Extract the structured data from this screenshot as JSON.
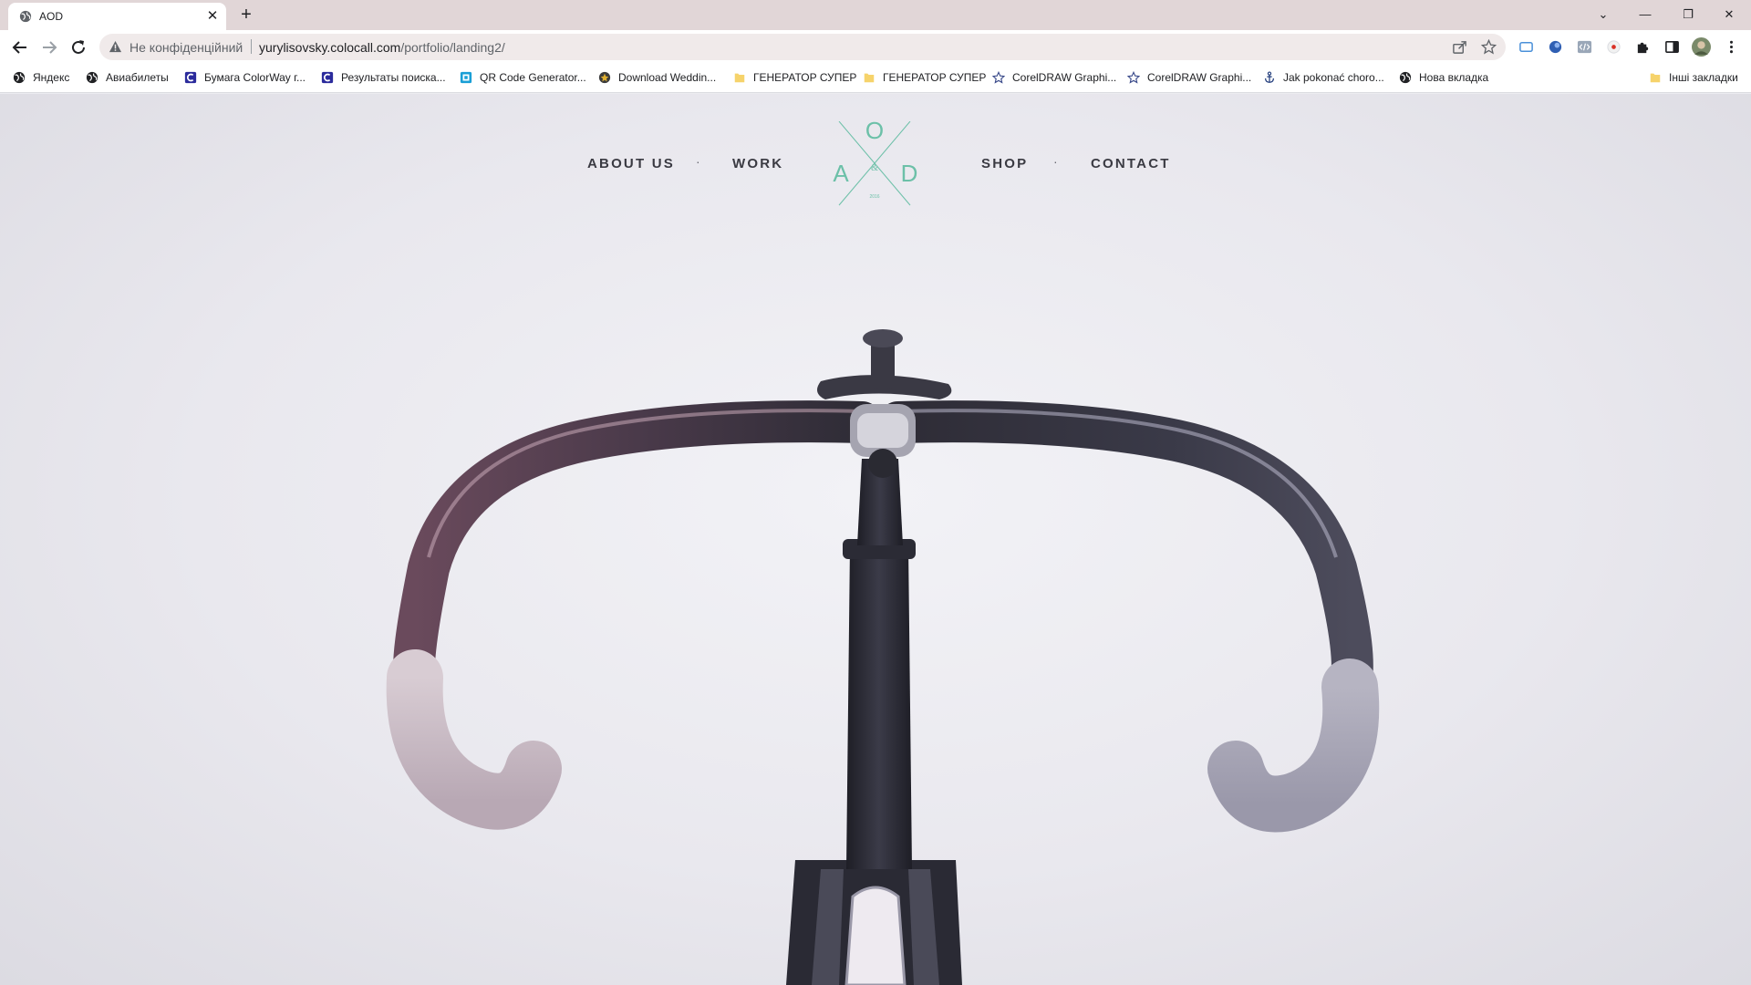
{
  "browser": {
    "tab": {
      "title": "AOD",
      "close_glyph": "✕",
      "favicon": "globe-icon"
    },
    "new_tab_glyph": "+",
    "window_controls": {
      "dropdown": "⌄",
      "minimize": "—",
      "restore": "❐",
      "close": "✕"
    },
    "address_bar": {
      "security_status": "Не конфіденційний",
      "url_host": "yurylisovsky.colocall.com",
      "url_path": "/portfolio/landing2/"
    }
  },
  "bookmarks": {
    "items": [
      {
        "label": "Яндекс",
        "icon": "globe-icon"
      },
      {
        "label": "Авиабилеты",
        "icon": "globe-icon"
      },
      {
        "label": "Бумага ColorWay г...",
        "icon": "c-logo-icon"
      },
      {
        "label": "Результаты поиска...",
        "icon": "c-logo-icon"
      },
      {
        "label": "QR Code Generator...",
        "icon": "qr-icon"
      },
      {
        "label": "Download Weddin...",
        "icon": "star-badge-icon"
      },
      {
        "label": "ГЕНЕРАТОР СУПЕР",
        "icon": "folder-icon"
      },
      {
        "label": "ГЕНЕРАТОР СУПЕР",
        "icon": "folder-icon"
      },
      {
        "label": "CorelDRAW Graphi...",
        "icon": "star-outline-icon"
      },
      {
        "label": "CorelDRAW Graphi...",
        "icon": "star-outline-icon"
      },
      {
        "label": "Jak pokonać choro...",
        "icon": "anchor-icon"
      },
      {
        "label": "Нова вкладка",
        "icon": "globe-icon"
      }
    ],
    "other": {
      "label": "Інші закладки",
      "icon": "folder-icon"
    }
  },
  "site": {
    "nav": {
      "about": "ABOUT US",
      "work": "WORK",
      "shop": "SHOP",
      "contact": "CONTACT",
      "separator": "·"
    },
    "logo": {
      "letter_a": "A",
      "letter_o": "O",
      "letter_d": "D",
      "ampersand": "&",
      "small_text": "2016"
    },
    "accent_color": "#6cc0a8"
  }
}
